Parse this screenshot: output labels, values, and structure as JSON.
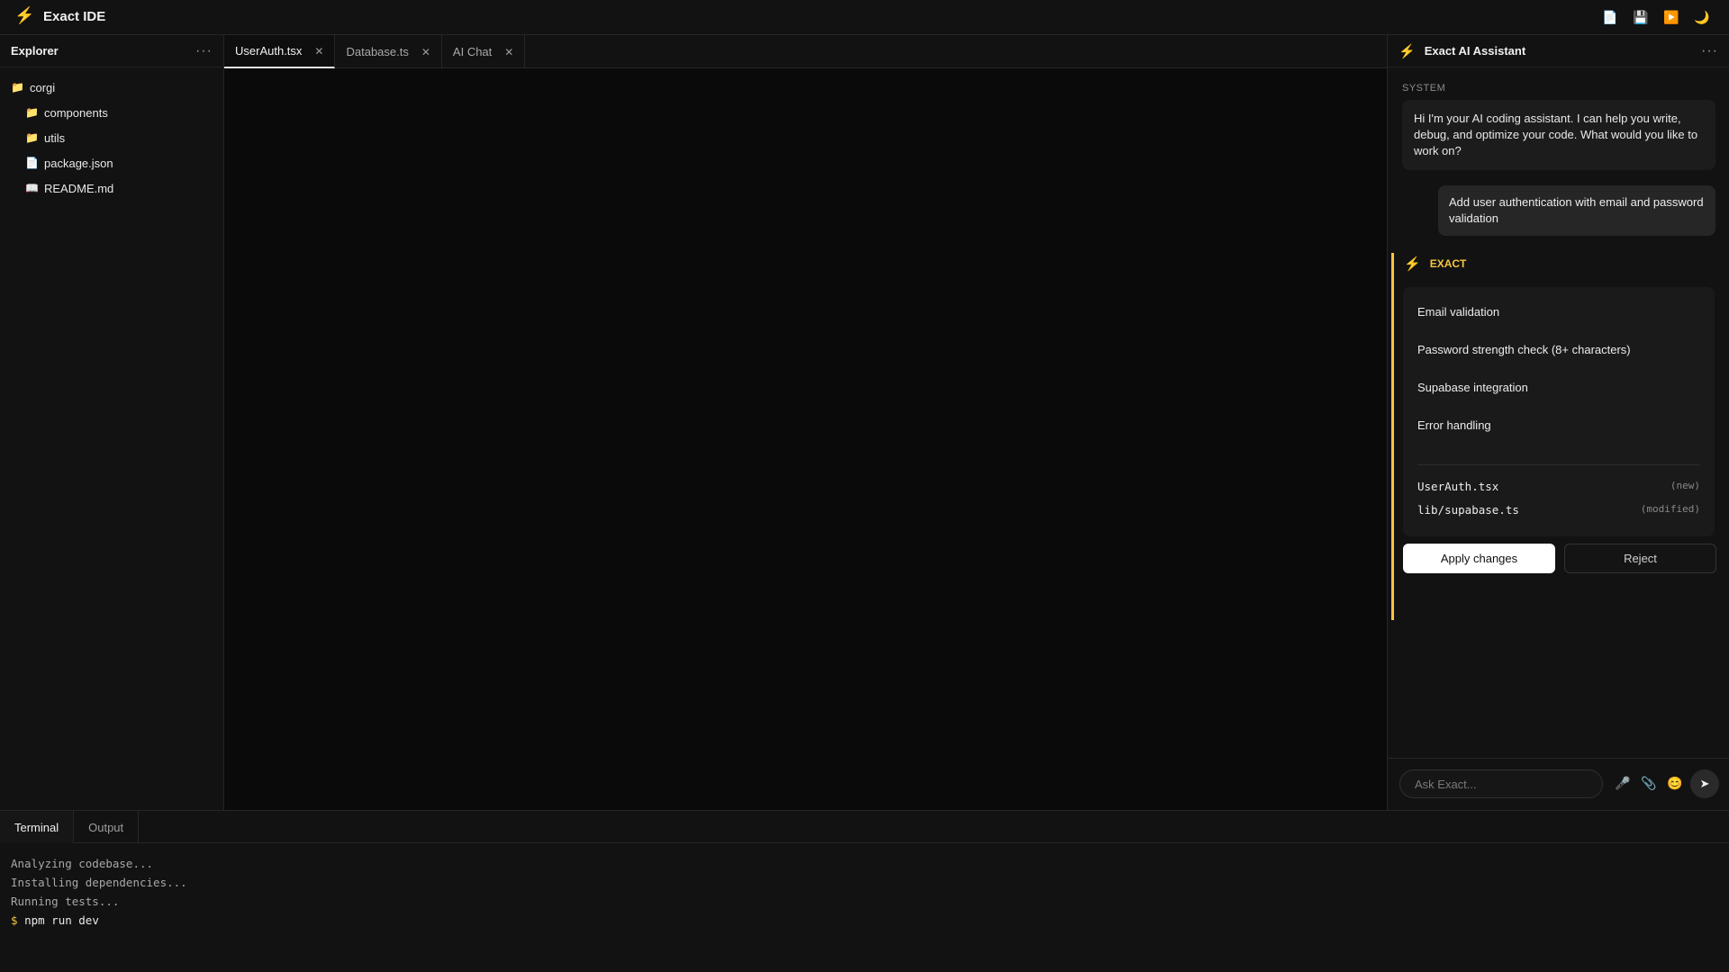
{
  "app": {
    "title": "Exact IDE"
  },
  "toolbar": {
    "new_file_icon": "document-icon",
    "save_icon": "save-icon",
    "run_icon": "play-icon",
    "theme_icon": "moon-icon"
  },
  "explorer": {
    "title": "Explorer",
    "items": [
      {
        "label": "corgi",
        "type": "folder",
        "level": 0
      },
      {
        "label": "components",
        "type": "folder",
        "level": 1
      },
      {
        "label": "utils",
        "type": "folder",
        "level": 1
      },
      {
        "label": "package.json",
        "type": "file",
        "level": 1
      },
      {
        "label": "README.md",
        "type": "readme",
        "level": 1
      }
    ]
  },
  "tabs": [
    {
      "label": "UserAuth.tsx",
      "active": true
    },
    {
      "label": "Database.ts",
      "active": false
    },
    {
      "label": "AI Chat",
      "active": false
    }
  ],
  "assistant": {
    "title": "Exact AI Assistant",
    "system_label": "SYSTEM",
    "system_message": "Hi I'm your AI coding assistant. I can help you write, debug, and optimize your code. What would you like to work on?",
    "user_message": "Add user authentication with email and password validation",
    "exact_label": "EXACT",
    "features": [
      "Email validation",
      "Password strength check (8+ characters)",
      "Supabase integration",
      "Error handling"
    ],
    "files": [
      {
        "name": "UserAuth.tsx",
        "status": "(new)"
      },
      {
        "name": "lib/supabase.ts",
        "status": "(modified)"
      }
    ],
    "apply_label": "Apply changes",
    "reject_label": "Reject",
    "input_placeholder": "Ask Exact...",
    "send_symbol": "➤"
  },
  "bottom": {
    "tabs": [
      {
        "label": "Terminal",
        "active": true
      },
      {
        "label": "Output",
        "active": false
      }
    ],
    "terminal_lines": [
      "Analyzing codebase...",
      "Installing dependencies...",
      "Running tests..."
    ],
    "prompt_symbol": "$",
    "command": "npm run dev"
  },
  "colors": {
    "accent": "#f5c542",
    "background": "#0b0b0b",
    "panel": "#121212"
  }
}
